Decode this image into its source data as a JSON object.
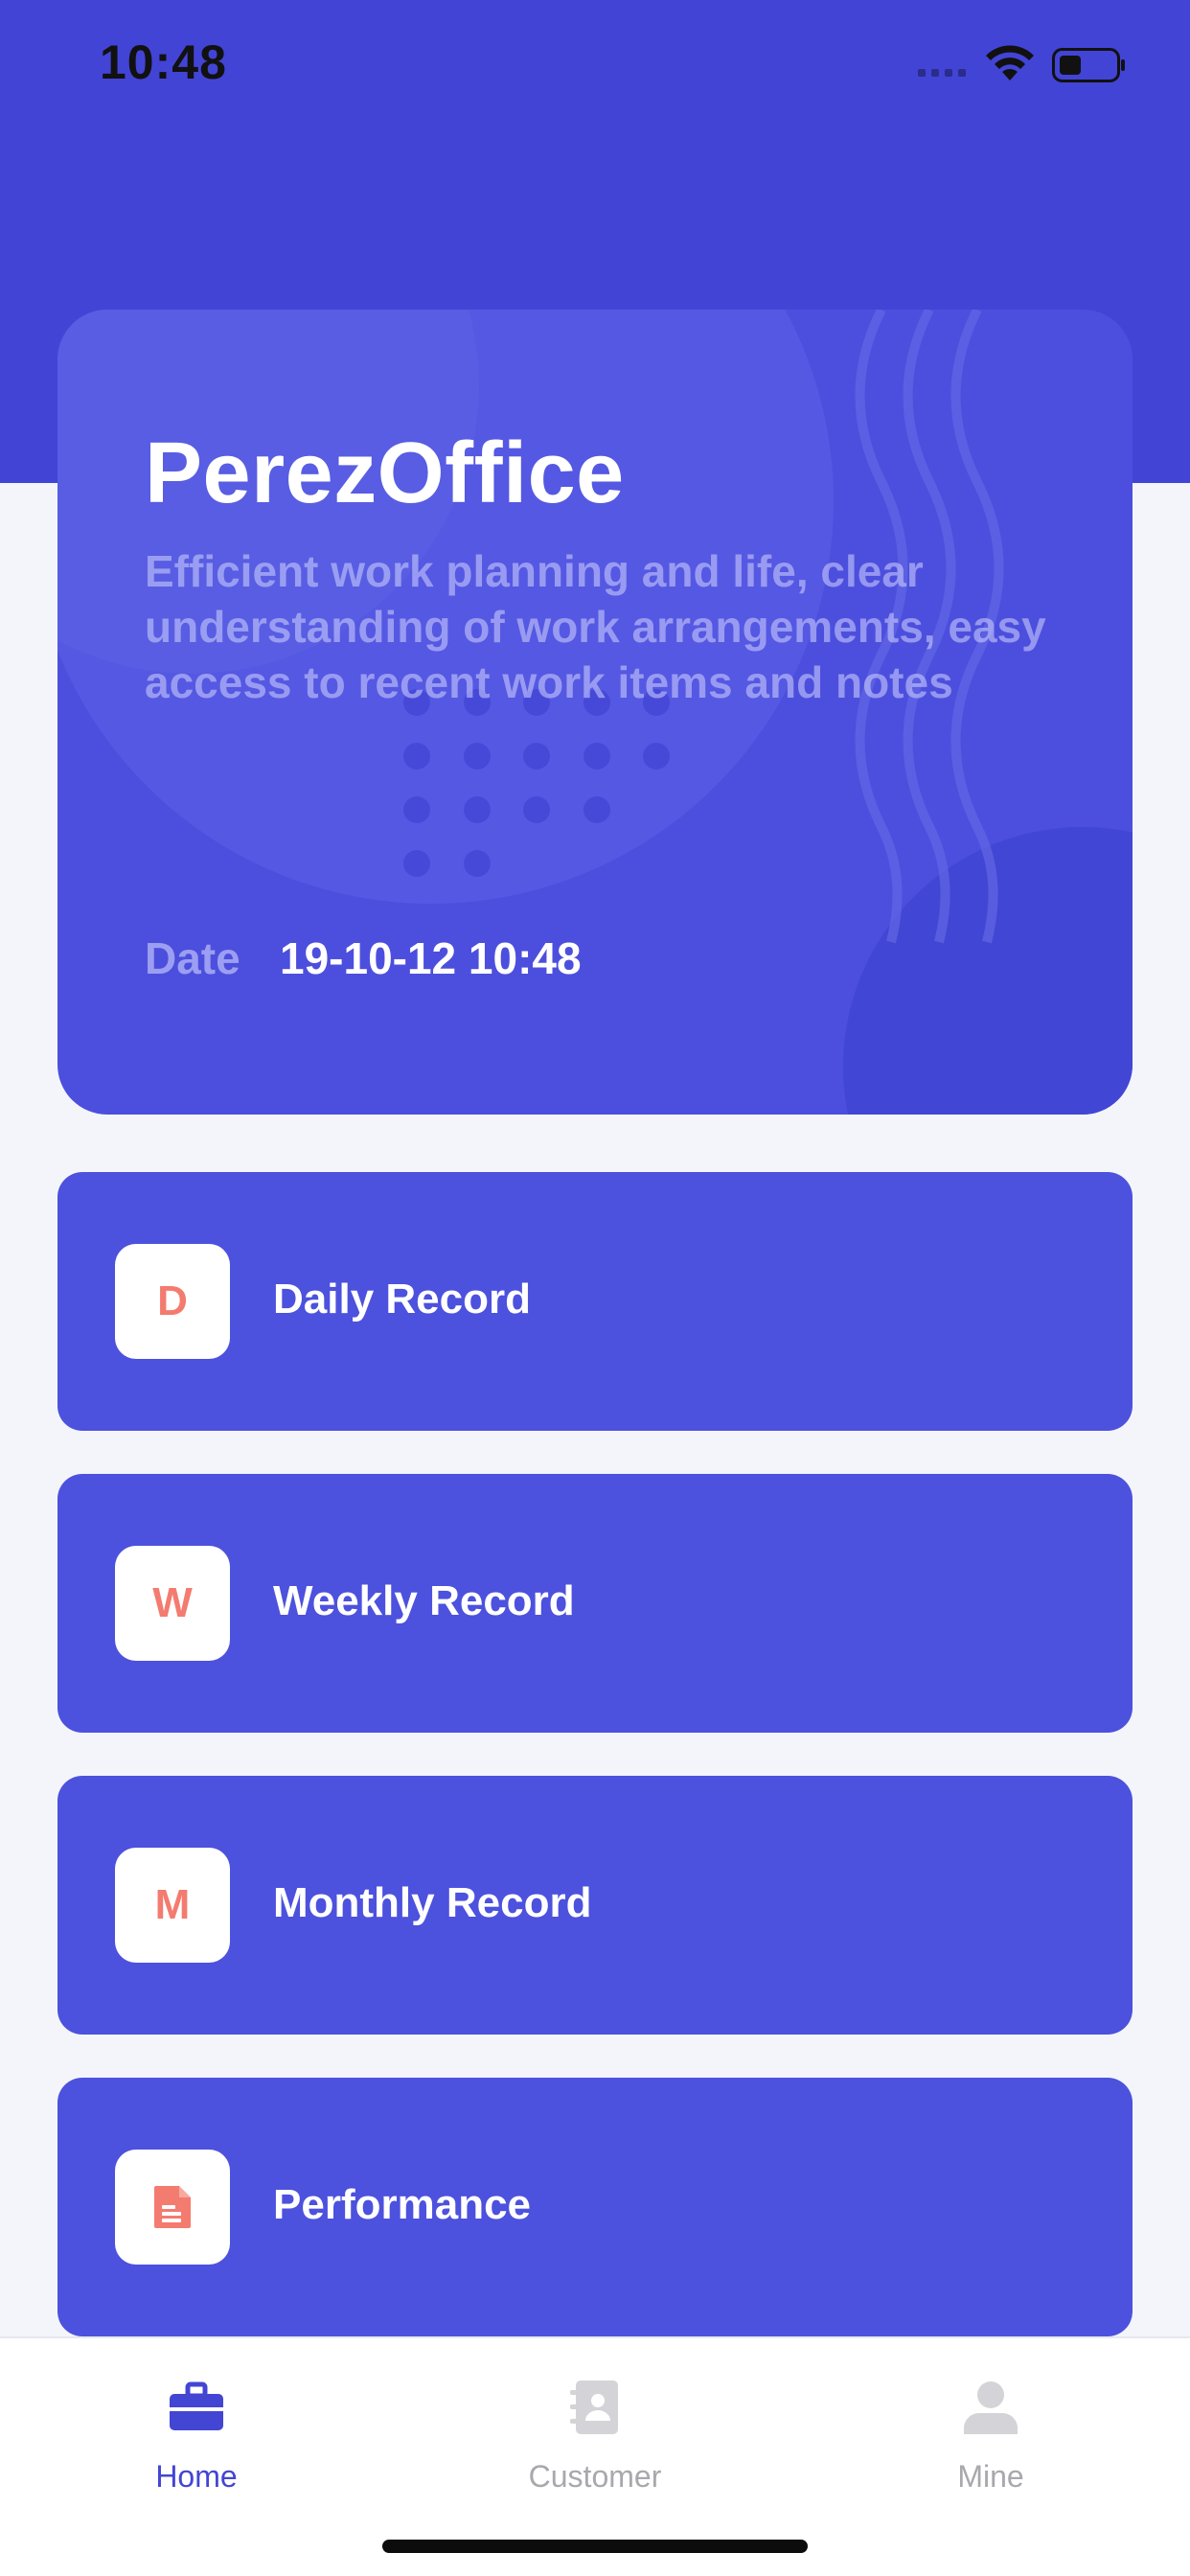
{
  "status_bar": {
    "time": "10:48"
  },
  "hero": {
    "title": "PerezOffice",
    "description": "Efficient work planning and life, clear understanding of work arrangements, easy access to recent work items and notes",
    "date_label": "Date",
    "date_value": "19-10-12 10:48"
  },
  "records": [
    {
      "badge": "D",
      "label": "Daily Record"
    },
    {
      "badge": "W",
      "label": "Weekly Record"
    },
    {
      "badge": "M",
      "label": "Monthly Record"
    },
    {
      "badge_icon": "document-icon",
      "label": "Performance"
    }
  ],
  "tab_bar": {
    "tabs": [
      {
        "label": "Home",
        "icon": "briefcase-icon",
        "active": true
      },
      {
        "label": "Customer",
        "icon": "contacts-book-icon",
        "active": false
      },
      {
        "label": "Mine",
        "icon": "person-icon",
        "active": false
      }
    ]
  },
  "colors": {
    "primary": "#4244d6",
    "card": "#4c51de",
    "badge_accent": "#f47b6f",
    "tab_active": "#4346d3",
    "tab_inactive": "#a8a8ad",
    "background": "#f4f5fa"
  }
}
